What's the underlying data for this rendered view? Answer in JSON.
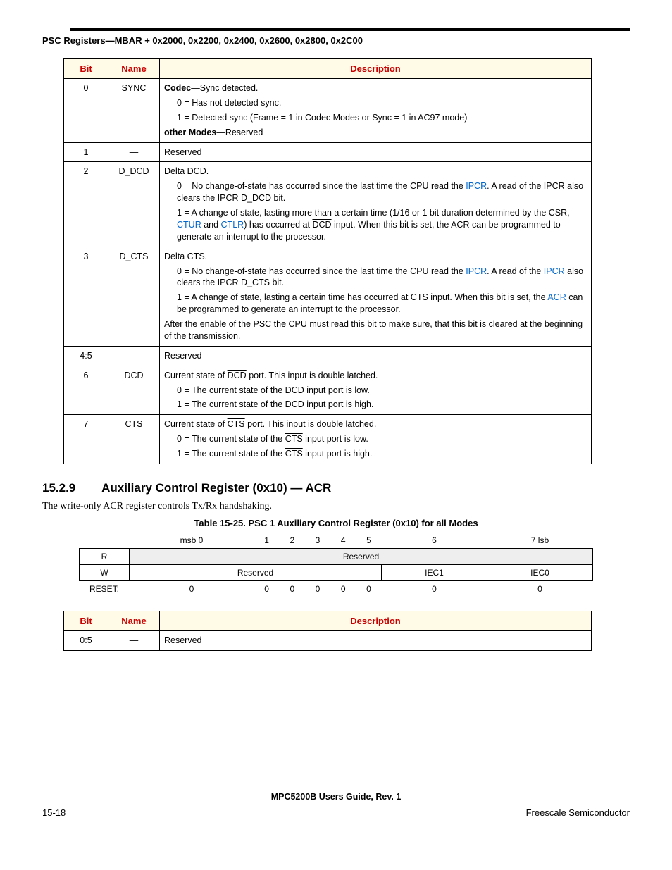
{
  "header": "PSC Registers—MBAR + 0x2000, 0x2200, 0x2400, 0x2600, 0x2800, 0x2C00",
  "table1": {
    "headers": {
      "bit": "Bit",
      "name": "Name",
      "desc": "Description"
    },
    "rows": [
      {
        "bit": "0",
        "name": "SYNC"
      },
      {
        "bit": "1",
        "name": "—",
        "desc": "Reserved"
      },
      {
        "bit": "2",
        "name": "D_DCD"
      },
      {
        "bit": "3",
        "name": "D_CTS"
      },
      {
        "bit": "4:5",
        "name": "—",
        "desc": "Reserved"
      },
      {
        "bit": "6",
        "name": "DCD"
      },
      {
        "bit": "7",
        "name": "CTS"
      }
    ],
    "r0": {
      "l1a": "Codec",
      "l1b": "—Sync detected.",
      "l2": "0 = Has not detected sync.",
      "l3": "1 = Detected sync (Frame = 1 in Codec Modes or Sync = 1 in AC97 mode)",
      "l4a": "other Modes",
      "l4b": "—Reserved"
    },
    "r2": {
      "l1": "Delta DCD.",
      "l2a": "0 = No change-of-state has occurred since the last time the CPU read the ",
      "l2link1": "IPCR",
      "l2b": ". A read of the IPCR also clears the IPCR D_DCD bit.",
      "l3a": "1 = A change of state, lasting more than a certain time (1/16 or 1 bit duration determined by the CSR, ",
      "l3link1": "CTUR",
      "l3b": " and ",
      "l3link2": "CTLR",
      "l3c": ") has occurred at ",
      "l3over": "DCD",
      "l3d": " input. When this bit is set, the ACR can be programmed to generate an interrupt to the processor."
    },
    "r3": {
      "l1": "Delta CTS.",
      "l2a": "0 = No change-of-state has occurred since the last time the CPU read the ",
      "l2link1": "IPCR",
      "l2b": ". A read of the ",
      "l2link2": "IPCR",
      "l2c": " also clears the IPCR D_CTS bit.",
      "l3a": "1 = A change of state, lasting a certain time has occurred at ",
      "l3over": "CTS",
      "l3b": " input. When this bit is set, the ",
      "l3link1": "ACR",
      "l3c": " can be programmed to generate an interrupt to the processor.",
      "l4": "After the enable of the PSC the CPU must read this bit to make sure, that this bit is cleared at the beginning of the transmission."
    },
    "r6": {
      "l1a": "Current state of ",
      "l1over": "DCD",
      "l1b": " port. This input is double latched.",
      "l2": "0 = The current state of the DCD input port is low.",
      "l3": "1 = The current state of the DCD input port is high."
    },
    "r7": {
      "l1a": "Current state of ",
      "l1over": "CTS",
      "l1b": " port. This input is double latched.",
      "l2a": "0 = The current state of the ",
      "l2over": "CTS",
      "l2b": " input port is low.",
      "l3a": "1 = The current state of the ",
      "l3over": "CTS",
      "l3b": " input port is high."
    }
  },
  "section": {
    "num": "15.2.9",
    "title": "Auxiliary Control Register (0x10) — ACR",
    "body": "The write-only ACR register controls Tx/Rx handshaking.",
    "caption": "Table 15-25. PSC 1 Auxiliary Control Register (0x10) for all Modes"
  },
  "reg": {
    "bits": [
      "msb 0",
      "1",
      "2",
      "3",
      "4",
      "5",
      "6",
      "7 lsb"
    ],
    "r_label": "R",
    "r_content": "Reserved",
    "w_label": "W",
    "w_reserved": "Reserved",
    "w_iec1": "IEC1",
    "w_iec0": "IEC0",
    "reset_label": "RESET:",
    "reset": [
      "0",
      "0",
      "0",
      "0",
      "0",
      "0",
      "0",
      "0"
    ]
  },
  "table2": {
    "headers": {
      "bit": "Bit",
      "name": "Name",
      "desc": "Description"
    },
    "row": {
      "bit": "0:5",
      "name": "—",
      "desc": "Reserved"
    }
  },
  "footer": {
    "center": "MPC5200B Users Guide, Rev. 1",
    "left": "15-18",
    "right": "Freescale Semiconductor"
  }
}
